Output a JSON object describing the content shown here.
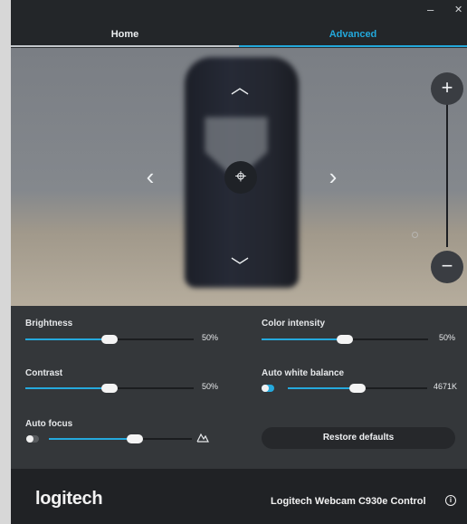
{
  "window": {
    "minimize_glyph": "–",
    "close_glyph": "✕"
  },
  "tabs": [
    {
      "label": "Home",
      "active": false
    },
    {
      "label": "Advanced",
      "active": true
    }
  ],
  "accent_color": "#25a9dd",
  "preview": {
    "up_icon": "︿",
    "down_icon": "﹀",
    "left_icon": "‹",
    "right_icon": "›",
    "center_icon": "⌖",
    "zoom_in_icon": "+",
    "zoom_out_icon": "−"
  },
  "controls": {
    "brightness": {
      "label": "Brightness",
      "value": "50%",
      "level": 0.5
    },
    "color_intensity": {
      "label": "Color intensity",
      "value": "50%",
      "level": 0.5
    },
    "contrast": {
      "label": "Contrast",
      "value": "50%",
      "level": 0.5
    },
    "auto_white_balance": {
      "label": "Auto white balance",
      "value": "4671K",
      "level": 0.5,
      "toggle_on": true
    },
    "auto_focus": {
      "label": "Auto focus",
      "level": 0.6,
      "toggle_on": false,
      "end_icon": "mountain-icon"
    },
    "restore_label": "Restore defaults"
  },
  "footer": {
    "brand": "logitech",
    "product": "Logitech Webcam C930e Control",
    "info_icon": "i"
  }
}
